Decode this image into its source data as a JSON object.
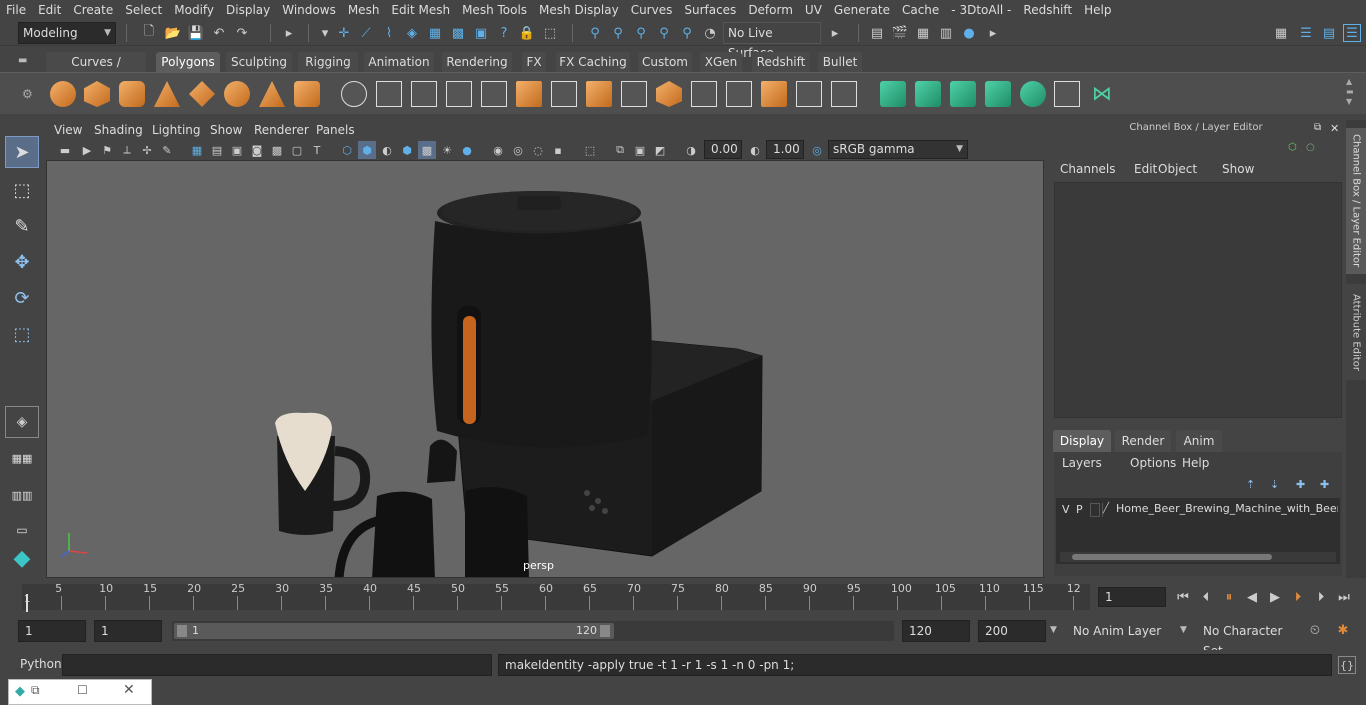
{
  "menubar": [
    "File",
    "Edit",
    "Create",
    "Select",
    "Modify",
    "Display",
    "Windows",
    "Mesh",
    "Edit Mesh",
    "Mesh Tools",
    "Mesh Display",
    "Curves",
    "Surfaces",
    "Deform",
    "UV",
    "Generate",
    "Cache",
    "- 3DtoAll -",
    "Redshift",
    "Help"
  ],
  "status": {
    "mode": "Modeling",
    "live_surface": "No Live Surface"
  },
  "shelf_tabs": [
    "Curves / Surfaces",
    "Polygons",
    "Sculpting",
    "Rigging",
    "Animation",
    "Rendering",
    "FX",
    "FX Caching",
    "Custom",
    "XGen",
    "Redshift",
    "Bullet"
  ],
  "shelf_active": "Polygons",
  "viewport": {
    "menu": [
      "View",
      "Shading",
      "Lighting",
      "Show",
      "Renderer",
      "Panels"
    ],
    "exposure": "0.00",
    "gamma": "1.00",
    "colorspace": "sRGB gamma",
    "camera_label": "persp"
  },
  "channel_box": {
    "title": "Channel Box / Layer Editor",
    "menu": [
      "Channels",
      "Edit",
      "Object",
      "Show"
    ],
    "tabs": [
      "Display",
      "Render",
      "Anim"
    ],
    "active_tab": "Display",
    "layer_menu": [
      "Layers",
      "Options",
      "Help"
    ],
    "layer": {
      "v": "V",
      "p": "P",
      "name": "Home_Beer_Brewing_Machine_with_Beer_M"
    }
  },
  "side_tabs": [
    "Channel Box / Layer Editor",
    "Attribute Editor"
  ],
  "timeline": {
    "ticks": [
      "5",
      "10",
      "15",
      "20",
      "25",
      "30",
      "35",
      "40",
      "45",
      "50",
      "55",
      "60",
      "65",
      "70",
      "75",
      "80",
      "85",
      "90",
      "95",
      "100",
      "105",
      "110",
      "115",
      "12"
    ],
    "start_marker": "1",
    "current_frame": "1"
  },
  "range": {
    "start": "1",
    "current": "1",
    "slider_start": "1",
    "slider_end": "120",
    "end": "120",
    "max": "200",
    "anim_layer": "No Anim Layer",
    "char_set": "No Character Set"
  },
  "cmd": {
    "lang": "Python",
    "output": "makeIdentity -apply true -t 1 -r 1 -s 1 -n 0 -pn 1;"
  }
}
